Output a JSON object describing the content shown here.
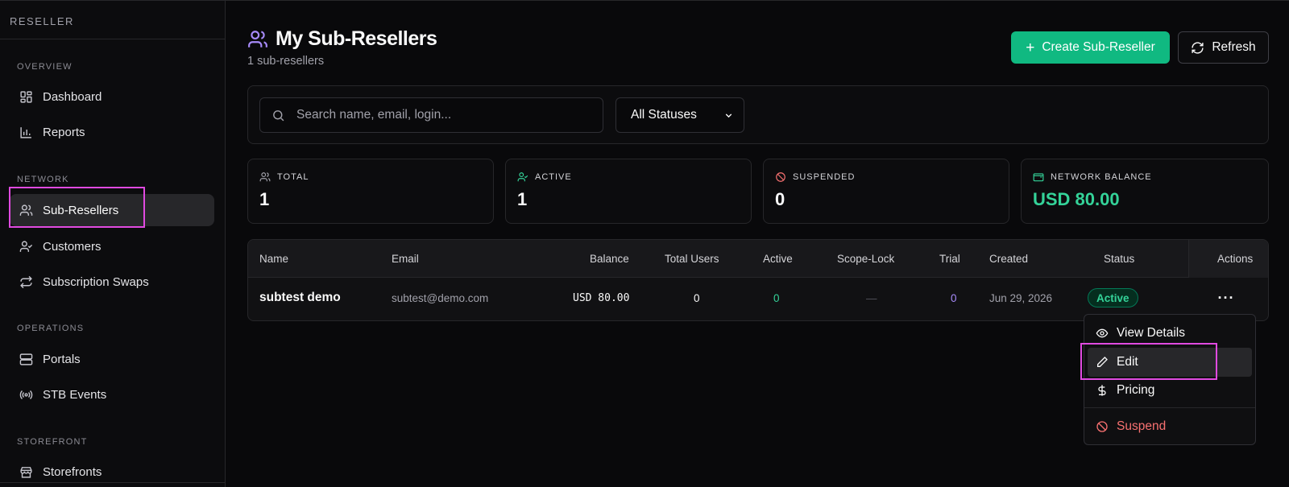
{
  "sidebar": {
    "brand": "RESELLER",
    "sections": {
      "overview": "OVERVIEW",
      "network": "NETWORK",
      "operations": "OPERATIONS",
      "storefront": "STOREFRONT"
    },
    "items": {
      "dashboard": "Dashboard",
      "reports": "Reports",
      "sub_resellers": "Sub-Resellers",
      "customers": "Customers",
      "subscription_swaps": "Subscription Swaps",
      "portals": "Portals",
      "stb_events": "STB Events",
      "storefronts": "Storefronts"
    },
    "active_item": "Sub-Resellers"
  },
  "header": {
    "title": "My Sub-Resellers",
    "subtitle": "1 sub-resellers",
    "create_label": "Create Sub-Reseller",
    "refresh_label": "Refresh"
  },
  "filters": {
    "search_placeholder": "Search name, email, login...",
    "status_selected": "All Statuses"
  },
  "stats": {
    "total_label": "TOTAL",
    "total_value": "1",
    "active_label": "ACTIVE",
    "active_value": "1",
    "suspended_label": "SUSPENDED",
    "suspended_value": "0",
    "balance_label": "NETWORK BALANCE",
    "balance_value": "USD 80.00"
  },
  "table": {
    "columns": {
      "name": "Name",
      "email": "Email",
      "balance": "Balance",
      "total_users": "Total Users",
      "active": "Active",
      "scope_lock": "Scope-Lock",
      "trial": "Trial",
      "created": "Created",
      "status": "Status",
      "actions": "Actions"
    },
    "rows": [
      {
        "name": "subtest demo",
        "email": "subtest@demo.com",
        "balance": "USD 80.00",
        "total_users": "0",
        "active": "0",
        "scope_lock": "—",
        "trial": "0",
        "created": "Jun 29, 2026",
        "status": "Active"
      }
    ]
  },
  "menu": {
    "view_details": "View Details",
    "edit": "Edit",
    "pricing": "Pricing",
    "suspend": "Suspend"
  },
  "colors": {
    "accent_green": "#10b981",
    "accent_purple": "#a78bfa",
    "danger": "#f87171",
    "highlight": "#e04ae0"
  }
}
